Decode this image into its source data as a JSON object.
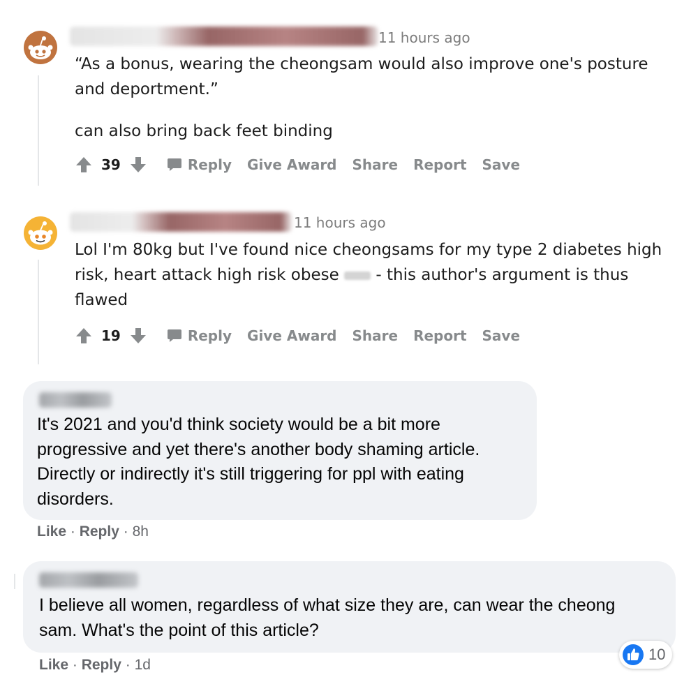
{
  "reddit_comments": [
    {
      "timestamp": "11 hours ago",
      "body": [
        "“As a bonus, wearing the cheongsam would also improve one's posture and deportment.”",
        "can also bring back feet binding"
      ],
      "score": "39",
      "actions": {
        "reply": "Reply",
        "give_award": "Give Award",
        "share": "Share",
        "report": "Report",
        "save": "Save"
      }
    },
    {
      "timestamp": "11 hours ago",
      "body_before": "Lol I'm 80kg but I've found nice cheongsams for my type 2 diabetes high risk, heart attack high risk obese",
      "body_after": "- this author's argument is thus flawed",
      "score": "19",
      "actions": {
        "reply": "Reply",
        "give_award": "Give Award",
        "share": "Share",
        "report": "Report",
        "save": "Save"
      }
    }
  ],
  "facebook_comments": [
    {
      "text": "It's 2021 and you'd think society would be a bit more progressive and yet there's another body shaming article. Directly or indirectly it's still triggering for ppl with eating disorders.",
      "like": "Like",
      "reply": "Reply",
      "time": "8h"
    },
    {
      "text": "I believe all women, regardless of what size they are, can wear the cheong sam. What's the point of this article?",
      "like": "Like",
      "reply": "Reply",
      "time": "1d",
      "reaction_count": "10"
    }
  ],
  "colors": {
    "reddit_meta": "#878a8c",
    "fb_bubble": "#f0f2f5",
    "fb_like_blue": "#1877f2",
    "avatar_1": "#c0733f",
    "avatar_2": "#f5b335"
  },
  "icons": [
    "snoo-avatar-icon",
    "upvote-icon",
    "downvote-icon",
    "comment-bubble-icon",
    "like-thumb-icon"
  ]
}
